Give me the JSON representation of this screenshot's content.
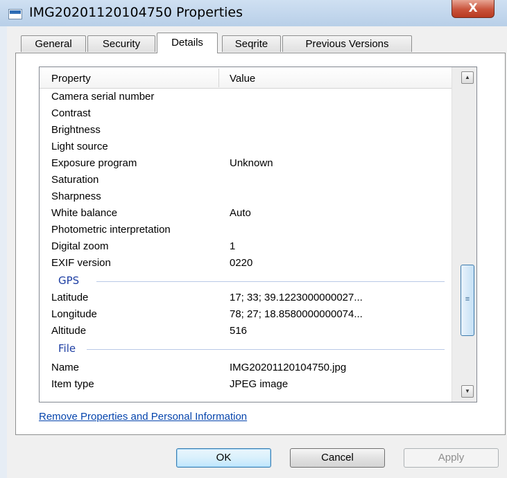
{
  "window": {
    "title": "IMG20201120104750 Properties",
    "close_glyph": "X"
  },
  "tabs": [
    {
      "label": "General",
      "active": false
    },
    {
      "label": "Security",
      "active": false
    },
    {
      "label": "Details",
      "active": true
    },
    {
      "label": "Seqrite",
      "active": false
    },
    {
      "label": "Previous Versions",
      "active": false
    }
  ],
  "details": {
    "columns": {
      "property": "Property",
      "value": "Value"
    },
    "rows": [
      {
        "property": "Camera serial number",
        "value": ""
      },
      {
        "property": "Contrast",
        "value": ""
      },
      {
        "property": "Brightness",
        "value": ""
      },
      {
        "property": "Light source",
        "value": ""
      },
      {
        "property": "Exposure program",
        "value": "Unknown"
      },
      {
        "property": "Saturation",
        "value": ""
      },
      {
        "property": "Sharpness",
        "value": ""
      },
      {
        "property": "White balance",
        "value": "Auto"
      },
      {
        "property": "Photometric interpretation",
        "value": ""
      },
      {
        "property": "Digital zoom",
        "value": "1"
      },
      {
        "property": "EXIF version",
        "value": "0220"
      }
    ],
    "gps_group": "GPS",
    "gps_rows": [
      {
        "property": "Latitude",
        "value": "17; 33; 39.1223000000027..."
      },
      {
        "property": "Longitude",
        "value": "78; 27; 18.8580000000074..."
      },
      {
        "property": "Altitude",
        "value": "516"
      }
    ],
    "file_group": "File",
    "file_rows": [
      {
        "property": "Name",
        "value": "IMG20201120104750.jpg"
      },
      {
        "property": "Item type",
        "value": "JPEG image"
      }
    ]
  },
  "remove_link": "Remove Properties and Personal Information",
  "buttons": {
    "ok": "OK",
    "cancel": "Cancel",
    "apply": "Apply"
  },
  "icons": {
    "window": "image-file-icon",
    "scroll_up": "scroll-up-arrow-icon",
    "scroll_down": "scroll-down-arrow-icon",
    "thumb_grip": "scroll-grip-icon"
  }
}
